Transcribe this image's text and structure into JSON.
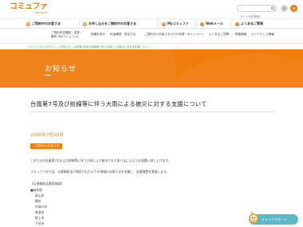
{
  "header": {
    "logo_text": "コミュファ",
    "logo_sub": "commufa",
    "search_placeholder": "サイト内を検索",
    "font_small": "小",
    "font_large": "大"
  },
  "mainnav": [
    {
      "label": "ご契約中のお客さま",
      "icon": "person-icon"
    },
    {
      "label": "お申し込みをご検討中のお客さま",
      "icon": "document-icon"
    },
    {
      "label": "Myコミュファ",
      "icon": "heart-icon"
    },
    {
      "label": "Webメール",
      "icon": "mail-icon"
    },
    {
      "label": "よくあるご質問",
      "icon": "question-icon"
    }
  ],
  "subnav": {
    "row1": [
      "ご契約内容確認・変更・",
      "各種手続き",
      "料金確認・設定方法",
      "ご契約中のお客さまだけの特典・キャンペーン",
      "よくあるご質問",
      "障害情報",
      "メンテナンス情報"
    ],
    "row1_sub": "解約 (Myコミュファ)"
  },
  "breadcrumb": "コミュファ光 公式サイト > お知らせ > 台風第7号及び前線等に伴う大雨による被災に対する支援について",
  "banner": {
    "title": "お知らせ"
  },
  "article": {
    "title": "台風第7号及び前線等に伴う大雨による被災に対する支援について",
    "date": "2018年7月10日",
    "category": "ご契約中のお客さま",
    "paragraph1": "このたびの台風第7号および前線等に伴う大雨により被災された皆さまに心よりお見舞い申し上げます。",
    "paragraph2": "コミュファ光では、災害救助法が適用された以下の地域のお客さまを対象に、支援措置を実施します。",
    "region_title": "【災害救助法適用地域】",
    "region_pref": "■岐阜県",
    "cities": [
      "高山市",
      "関市",
      "中津川市",
      "美濃市",
      "郡上市",
      "下呂市"
    ]
  },
  "chatbot": {
    "label": "チャットサポート"
  }
}
